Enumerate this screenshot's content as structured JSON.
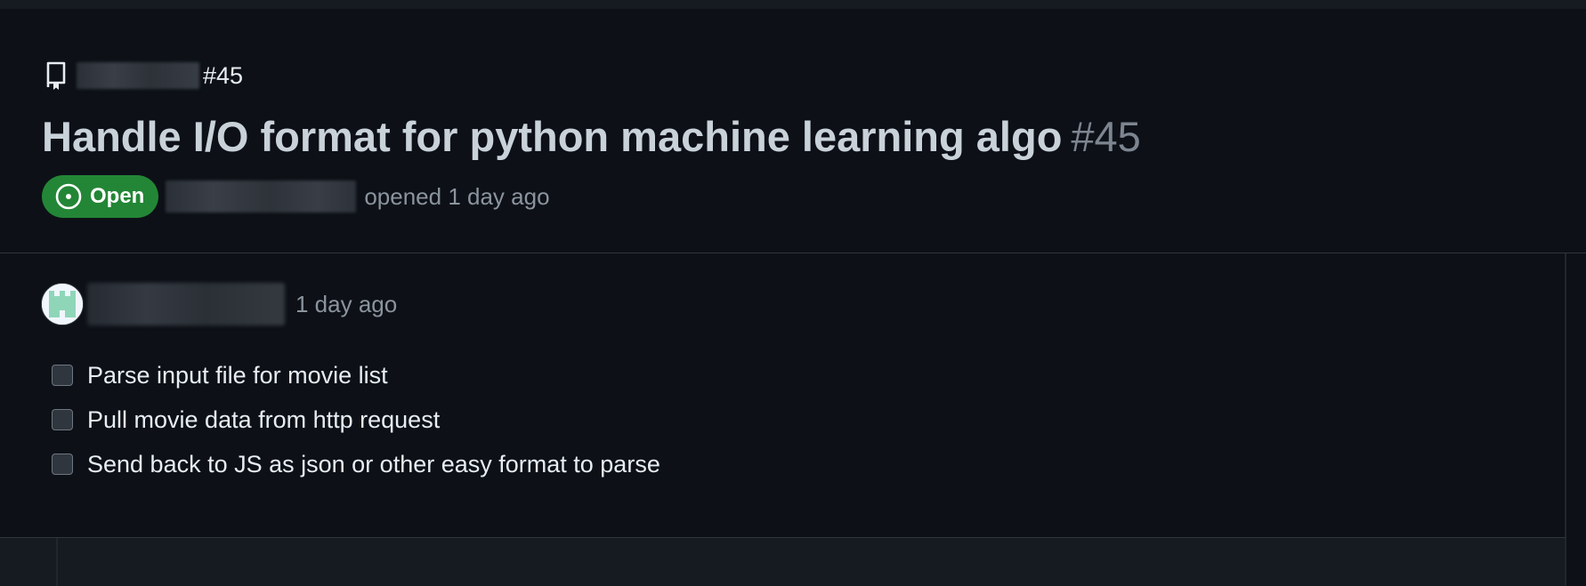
{
  "issue": {
    "ref": "#45",
    "title": "Handle I/O format for python machine learning algo",
    "number": "#45",
    "state": "Open",
    "opened_text": "opened 1 day ago"
  },
  "comment": {
    "time": "1 day ago",
    "tasks": [
      {
        "label": "Parse input file for movie list",
        "checked": false
      },
      {
        "label": "Pull movie data from http request",
        "checked": false
      },
      {
        "label": "Send back to JS as json or other easy format to parse",
        "checked": false
      }
    ]
  },
  "colors": {
    "background": "#0d1117",
    "open_badge": "#238636",
    "muted_text": "#8b949e",
    "avatar_accent": "#8fd6b8"
  },
  "icons": {
    "repo": "repo-icon",
    "state": "issue-opened-icon",
    "avatar": "identicon-avatar"
  }
}
